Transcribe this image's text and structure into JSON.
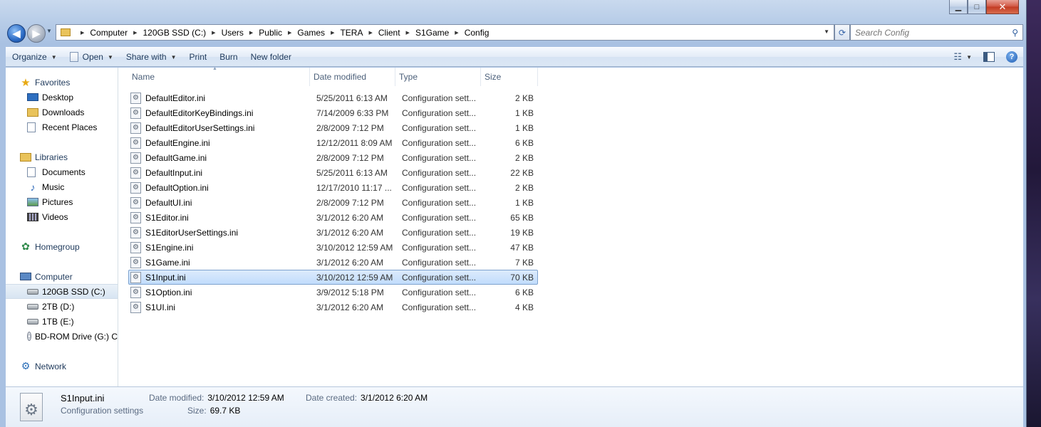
{
  "window": {
    "caption": {
      "minimize": "▁",
      "maximize": "□",
      "close": "✕"
    }
  },
  "navigation": {
    "back_icon": "arrow-left",
    "forward_icon": "arrow-right",
    "breadcrumb": [
      "Computer",
      "120GB SSD (C:)",
      "Users",
      "Public",
      "Games",
      "TERA",
      "Client",
      "S1Game",
      "Config"
    ],
    "search_placeholder": "Search Config"
  },
  "toolbar": {
    "organize": "Organize",
    "open": "Open",
    "share_with": "Share with",
    "print": "Print",
    "burn": "Burn",
    "new_folder": "New folder",
    "help": "?"
  },
  "nav_pane": {
    "favorites": "Favorites",
    "desktop": "Desktop",
    "downloads": "Downloads",
    "recent_places": "Recent Places",
    "libraries": "Libraries",
    "documents": "Documents",
    "music": "Music",
    "pictures": "Pictures",
    "videos": "Videos",
    "homegroup": "Homegroup",
    "computer": "Computer",
    "drive_c": "120GB SSD (C:)",
    "drive_d": "2TB (D:)",
    "drive_e": "1TB (E:)",
    "drive_g": "BD-ROM Drive (G:) C",
    "network": "Network"
  },
  "columns": {
    "name": "Name",
    "date_modified": "Date modified",
    "type": "Type",
    "size": "Size"
  },
  "files": [
    {
      "name": "DefaultEditor.ini",
      "date": "5/25/2011 6:13 AM",
      "type": "Configuration sett...",
      "size": "2 KB"
    },
    {
      "name": "DefaultEditorKeyBindings.ini",
      "date": "7/14/2009 6:33 PM",
      "type": "Configuration sett...",
      "size": "1 KB"
    },
    {
      "name": "DefaultEditorUserSettings.ini",
      "date": "2/8/2009 7:12 PM",
      "type": "Configuration sett...",
      "size": "1 KB"
    },
    {
      "name": "DefaultEngine.ini",
      "date": "12/12/2011 8:09 AM",
      "type": "Configuration sett...",
      "size": "6 KB"
    },
    {
      "name": "DefaultGame.ini",
      "date": "2/8/2009 7:12 PM",
      "type": "Configuration sett...",
      "size": "2 KB"
    },
    {
      "name": "DefaultInput.ini",
      "date": "5/25/2011 6:13 AM",
      "type": "Configuration sett...",
      "size": "22 KB"
    },
    {
      "name": "DefaultOption.ini",
      "date": "12/17/2010 11:17 ...",
      "type": "Configuration sett...",
      "size": "2 KB"
    },
    {
      "name": "DefaultUI.ini",
      "date": "2/8/2009 7:12 PM",
      "type": "Configuration sett...",
      "size": "1 KB"
    },
    {
      "name": "S1Editor.ini",
      "date": "3/1/2012 6:20 AM",
      "type": "Configuration sett...",
      "size": "65 KB"
    },
    {
      "name": "S1EditorUserSettings.ini",
      "date": "3/1/2012 6:20 AM",
      "type": "Configuration sett...",
      "size": "19 KB"
    },
    {
      "name": "S1Engine.ini",
      "date": "3/10/2012 12:59 AM",
      "type": "Configuration sett...",
      "size": "47 KB"
    },
    {
      "name": "S1Game.ini",
      "date": "3/1/2012 6:20 AM",
      "type": "Configuration sett...",
      "size": "7 KB"
    },
    {
      "name": "S1Input.ini",
      "date": "3/10/2012 12:59 AM",
      "type": "Configuration sett...",
      "size": "70 KB"
    },
    {
      "name": "S1Option.ini",
      "date": "3/9/2012 5:18 PM",
      "type": "Configuration sett...",
      "size": "6 KB"
    },
    {
      "name": "S1UI.ini",
      "date": "3/1/2012 6:20 AM",
      "type": "Configuration sett...",
      "size": "4 KB"
    }
  ],
  "selected_index": 12,
  "details": {
    "name": "S1Input.ini",
    "type": "Configuration settings",
    "date_modified_label": "Date modified:",
    "date_modified": "3/10/2012 12:59 AM",
    "date_created_label": "Date created:",
    "date_created": "3/1/2012 6:20 AM",
    "size_label": "Size:",
    "size": "69.7 KB"
  }
}
